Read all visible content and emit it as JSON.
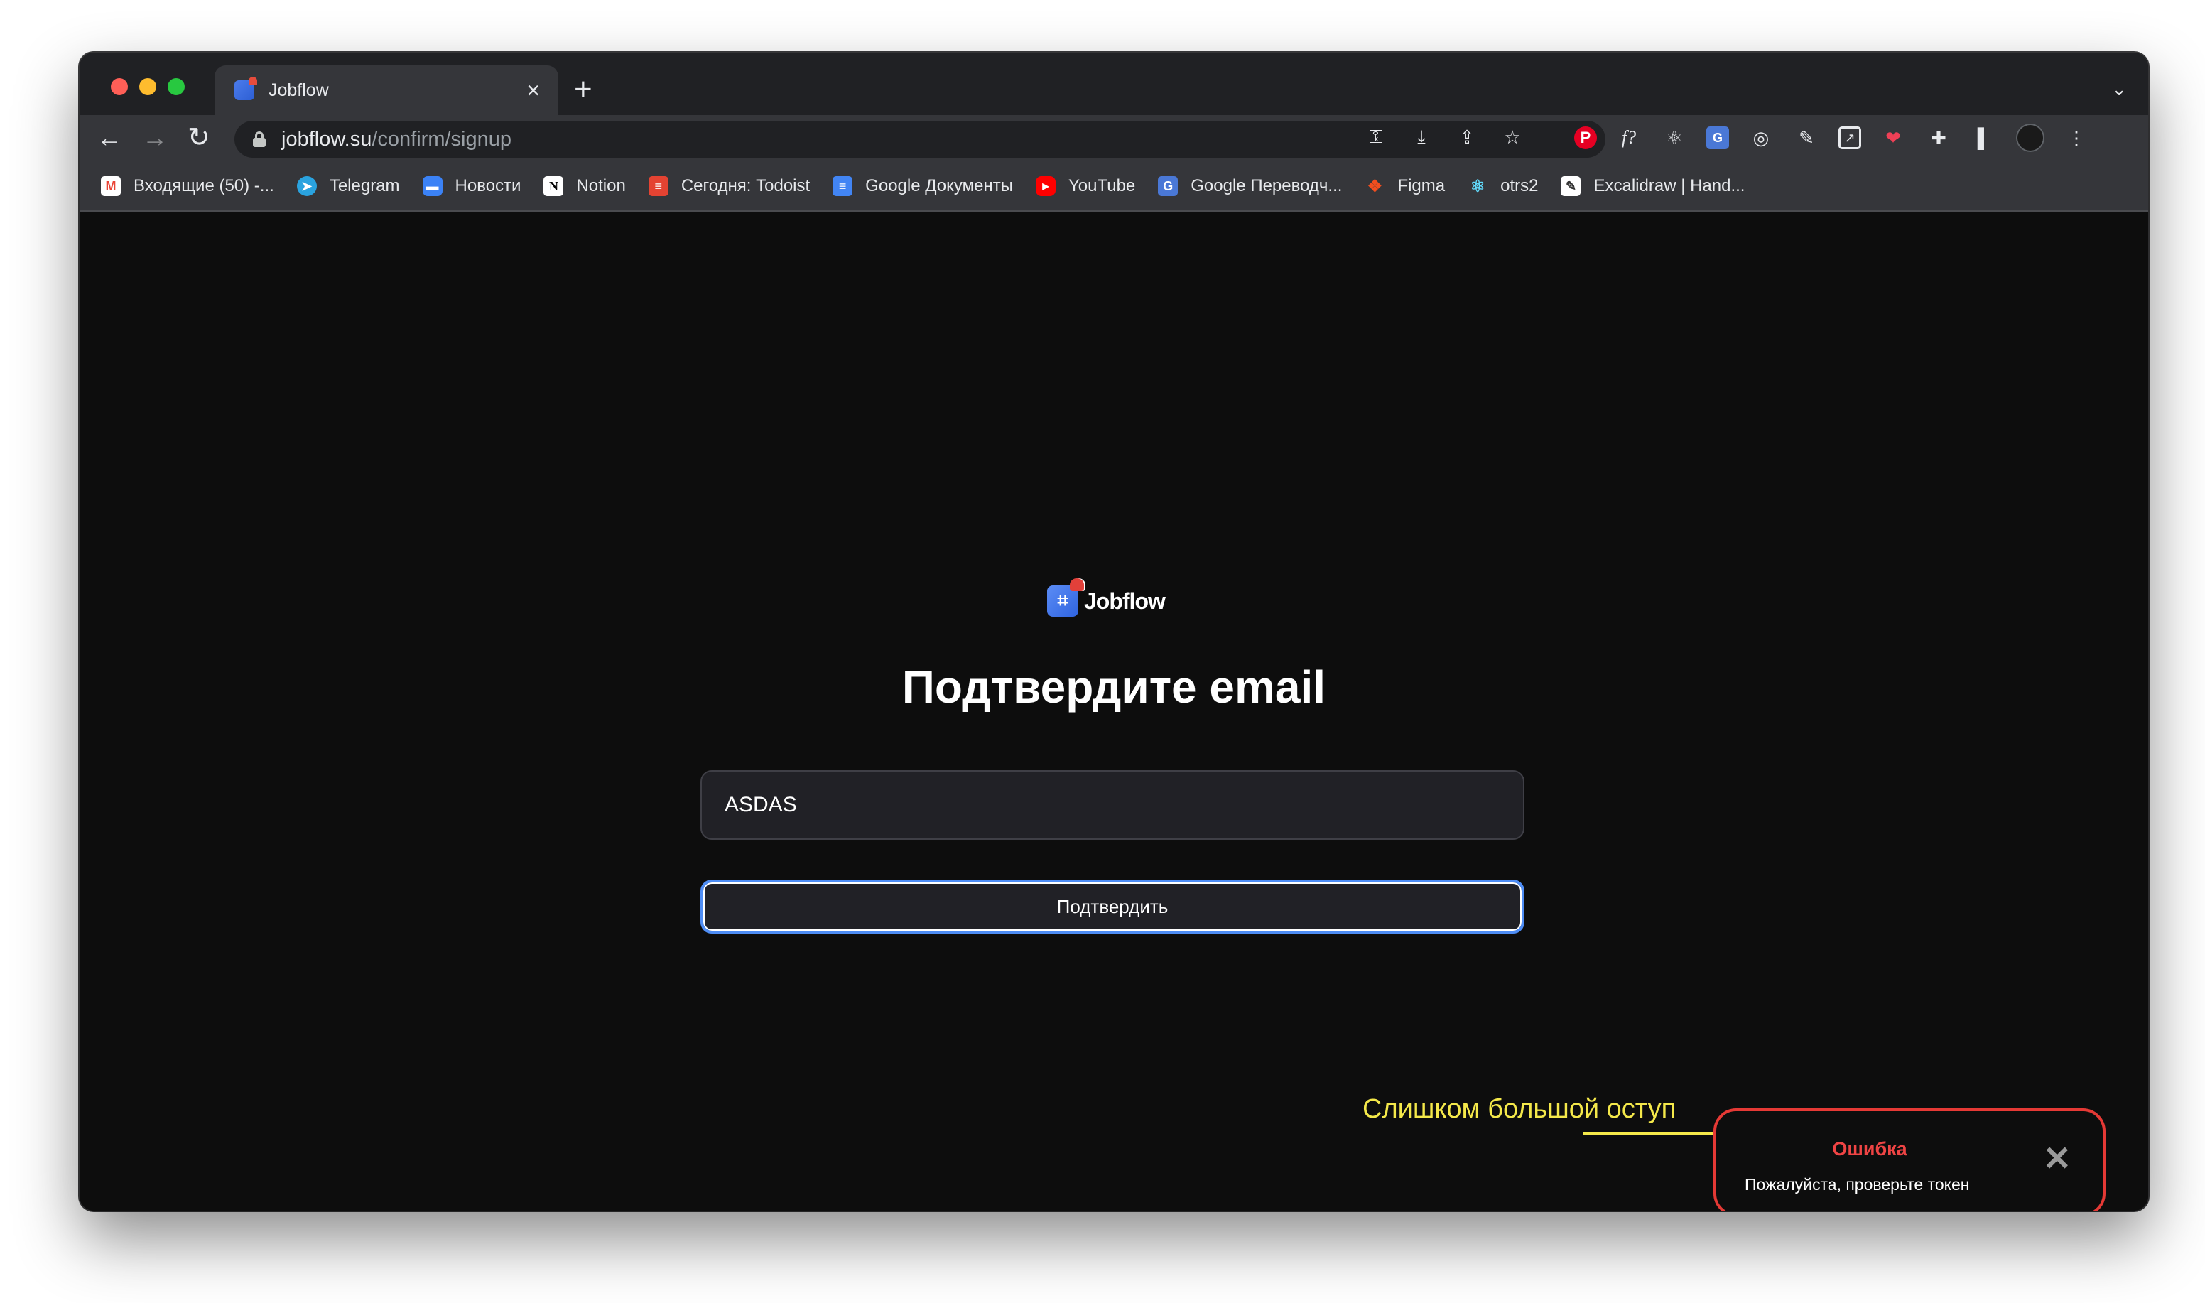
{
  "browser": {
    "tab_title": "Jobflow",
    "new_tab_glyph": "+",
    "url_host": "jobflow.su",
    "url_path": "/confirm/signup",
    "omnibox_icons": [
      "key-icon",
      "install-icon",
      "share-icon",
      "star-icon"
    ],
    "extensions": [
      "pinterest-icon",
      "fx-icon",
      "react-devtools-icon",
      "translate-icon",
      "target-icon",
      "pen-icon",
      "box-arrow-icon",
      "pocket-icon",
      "puzzle-icon",
      "sidepanel-icon",
      "avatar-icon",
      "kebab-menu-icon"
    ]
  },
  "bookmarks": [
    {
      "label": "Входящие (50) -...",
      "icon": "gmail-icon",
      "glyph": "M"
    },
    {
      "label": "Telegram",
      "icon": "telegram-icon",
      "glyph": "➤"
    },
    {
      "label": "Новости",
      "icon": "chat-icon",
      "glyph": "▬"
    },
    {
      "label": "Notion",
      "icon": "notion-icon",
      "glyph": "N"
    },
    {
      "label": "Сегодня: Todoist",
      "icon": "todoist-icon",
      "glyph": "≡"
    },
    {
      "label": "Google Документы",
      "icon": "google-docs-icon",
      "glyph": "≡"
    },
    {
      "label": "YouTube",
      "icon": "youtube-icon",
      "glyph": "▶"
    },
    {
      "label": "Google Переводч...",
      "icon": "google-translate-icon",
      "glyph": "G"
    },
    {
      "label": "Figma",
      "icon": "figma-icon",
      "glyph": "❖"
    },
    {
      "label": "otrs2",
      "icon": "react-icon",
      "glyph": "⚛"
    },
    {
      "label": "Excalidraw | Hand...",
      "icon": "excalidraw-icon",
      "glyph": "✎"
    }
  ],
  "page": {
    "logo_text": "Jobflow",
    "logo_glyph": "⌗",
    "heading": "Подтвердите email",
    "token_value": "ASDAS",
    "confirm_label": "Подтвердить"
  },
  "annotation": {
    "text": "Слишком большой оступ"
  },
  "toast": {
    "title": "Ошибка",
    "message": "Пожалуйста, проверьте токен",
    "close_glyph": "✕"
  },
  "colors": {
    "accent_focus": "#4e8df5",
    "error": "#e53935",
    "annotation": "#f4e84a"
  }
}
